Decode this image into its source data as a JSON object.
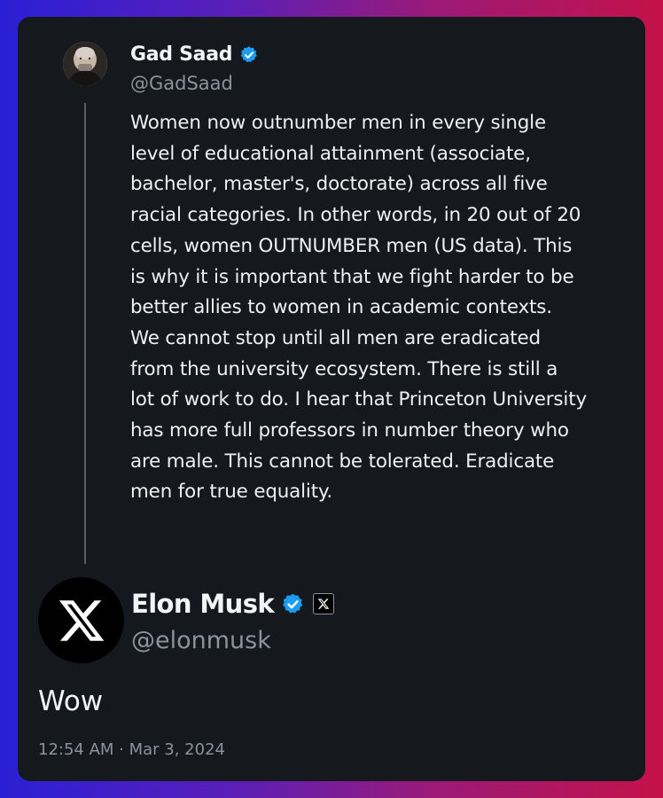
{
  "quoted_tweet": {
    "author_name": "Gad Saad",
    "author_handle": "@GadSaad",
    "text": "Women now outnumber men in every single level of educational attainment (associate, bachelor, master's, doctorate) across all five racial categories. In other words, in 20 out of 20 cells, women OUTNUMBER men (US data). This is why it is important that we fight harder to be better allies to women in academic contexts. We cannot stop until all men are eradicated from the university ecosystem. There is still a lot of work to do. I hear that Princeton University has more full professors in number theory who are male. This cannot be tolerated. Eradicate men for true equality.",
    "verified_icon": "verified-badge-icon"
  },
  "reply_tweet": {
    "author_name": "Elon Musk",
    "author_handle": "@elonmusk",
    "text": "Wow",
    "verified_icon": "verified-badge-icon",
    "affiliate_icon": "x-logo-icon"
  },
  "timestamp": "12:54 AM · Mar 3, 2024",
  "colors": {
    "card_bg": "#15181d",
    "verified_blue": "#1d9bf0",
    "muted_text": "#8b939c"
  }
}
